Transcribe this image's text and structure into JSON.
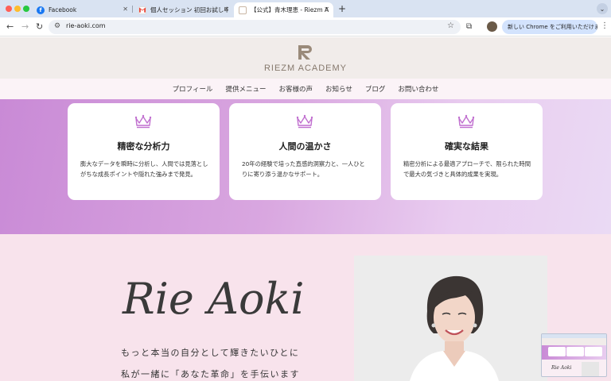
{
  "browser": {
    "tabs": [
      {
        "title": "Facebook",
        "favicon": "facebook-icon",
        "active": false
      },
      {
        "title": "個人セッション 初回お試し申込",
        "favicon": "gmail-icon",
        "active": false
      },
      {
        "title": "【公式】青木理恵 - Riezm Acad",
        "favicon": "site-icon",
        "active": true
      }
    ],
    "address": "rie-aoki.com",
    "chrome_promo": "新しい Chrome をご利用いただけます"
  },
  "site": {
    "brand": "RIEZM ACADEMY",
    "nav": [
      "プロフィール",
      "提供メニュー",
      "お客様の声",
      "お知らせ",
      "ブログ",
      "お問い合わせ"
    ],
    "features": [
      {
        "title": "精密な分析力",
        "body": "膨大なデータを瞬時に分析し、人間では見落としがちな成長ポイントや隠れた強みまで発見。"
      },
      {
        "title": "人間の温かさ",
        "body": "20年の経験で培った直感的洞察力と、一人ひとりに寄り添う温かなサポート。"
      },
      {
        "title": "確実な結果",
        "body": "精密分析による最適アプローチで、限られた時間で最大の気づきと具体的成果を実現。"
      }
    ],
    "hero": {
      "signature": "Rie Aoki",
      "tagline_1": "もっと本当の自分として輝きたいひとに",
      "tagline_2": "私が一緒に「あなた革命」を手伝います"
    }
  },
  "pip": {
    "signature": "Rie Aoki"
  },
  "colors": {
    "accent": "#c98ad6",
    "brand": "#85786c",
    "hero_bg": "#f8e3ec",
    "crown": "#c06fcf"
  }
}
